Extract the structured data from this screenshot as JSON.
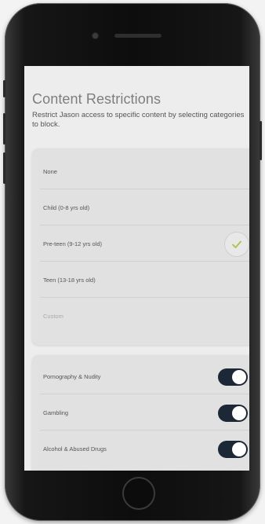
{
  "screen": {
    "title": "Content Restrictions",
    "subtitle": "Restrict Jason access to specific content by selecting categories to block."
  },
  "age_options": [
    {
      "label": "None",
      "selected": false
    },
    {
      "label": "Child (0-8 yrs old)",
      "selected": false
    },
    {
      "label": "Pre-teen (9-12 yrs old)",
      "selected": true
    },
    {
      "label": "Teen (13-18 yrs old)",
      "selected": false
    },
    {
      "label": "Custom",
      "selected": false
    }
  ],
  "categories": [
    {
      "label": "Pornography & Nudity",
      "enabled": true
    },
    {
      "label": "Gambling",
      "enabled": true
    },
    {
      "label": "Alcohol & Abused Drugs",
      "enabled": true
    }
  ],
  "colors": {
    "toggle_on": "#1d2836",
    "check": "#a8c34a",
    "background": "#ededed"
  }
}
